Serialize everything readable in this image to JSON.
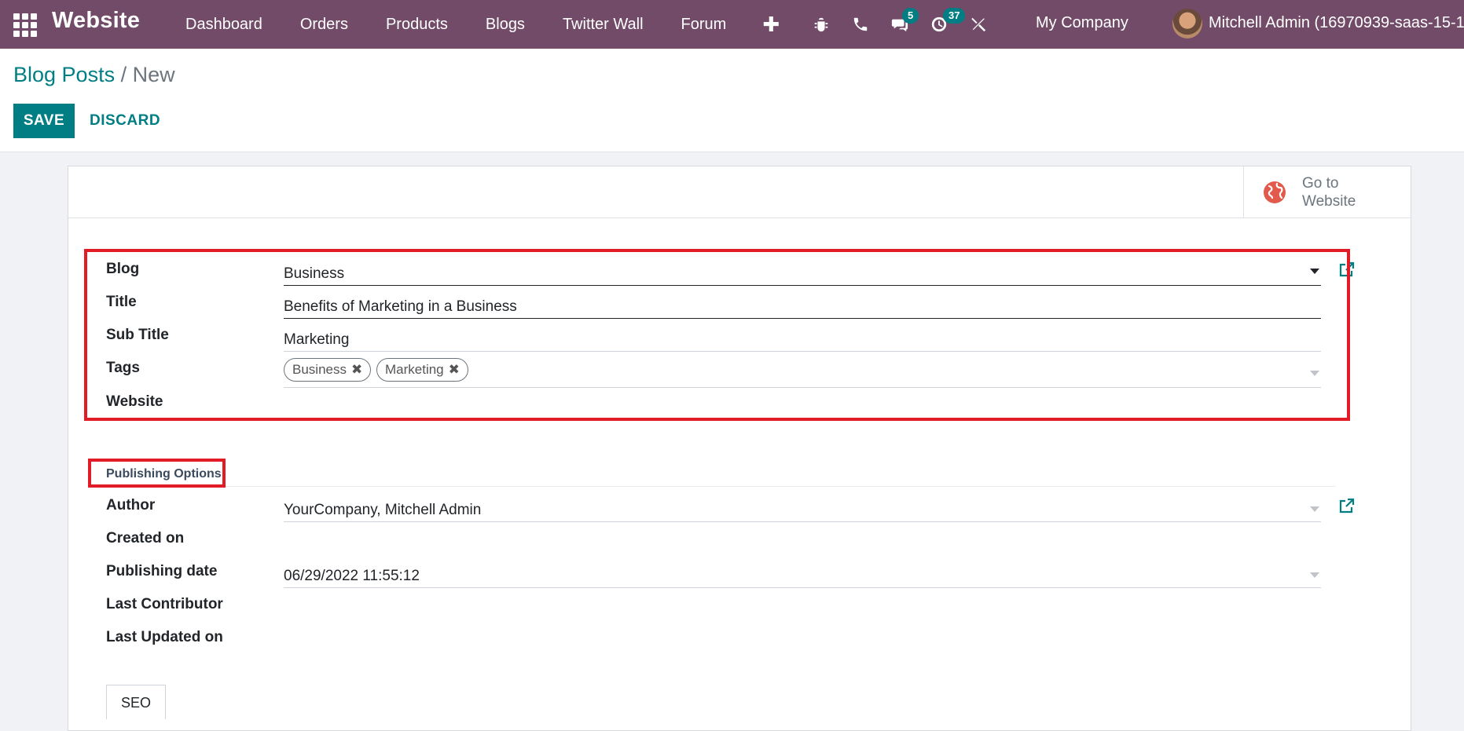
{
  "navbar": {
    "app_name": "Website",
    "menu": [
      "Dashboard",
      "Orders",
      "Products",
      "Blogs",
      "Twitter Wall",
      "Forum"
    ],
    "plus": "✚",
    "messages_badge": "5",
    "activities_badge": "37",
    "company": "My Company",
    "user": "Mitchell Admin (16970939-saas-15-1-"
  },
  "breadcrumb": {
    "parent": "Blog Posts",
    "separator": "/",
    "current": "New"
  },
  "buttons": {
    "save": "SAVE",
    "discard": "DISCARD",
    "go_to_website": "Go to Website"
  },
  "form": {
    "blog_label": "Blog",
    "blog_value": "Business",
    "title_label": "Title",
    "title_value": "Benefits of Marketing in a Business",
    "subtitle_label": "Sub Title",
    "subtitle_value": "Marketing",
    "tags_label": "Tags",
    "tags": [
      "Business",
      "Marketing"
    ],
    "website_label": "Website",
    "website_value": ""
  },
  "publishing": {
    "section_title": "Publishing Options",
    "author_label": "Author",
    "author_value": "YourCompany, Mitchell Admin",
    "created_label": "Created on",
    "publishing_date_label": "Publishing date",
    "publishing_date_value": "06/29/2022 11:55:12",
    "last_contributor_label": "Last Contributor",
    "last_updated_label": "Last Updated on"
  },
  "tabs": {
    "seo": "SEO"
  },
  "colors": {
    "navbar": "#714b67",
    "primary": "#017e84",
    "highlight": "#e21c27"
  }
}
